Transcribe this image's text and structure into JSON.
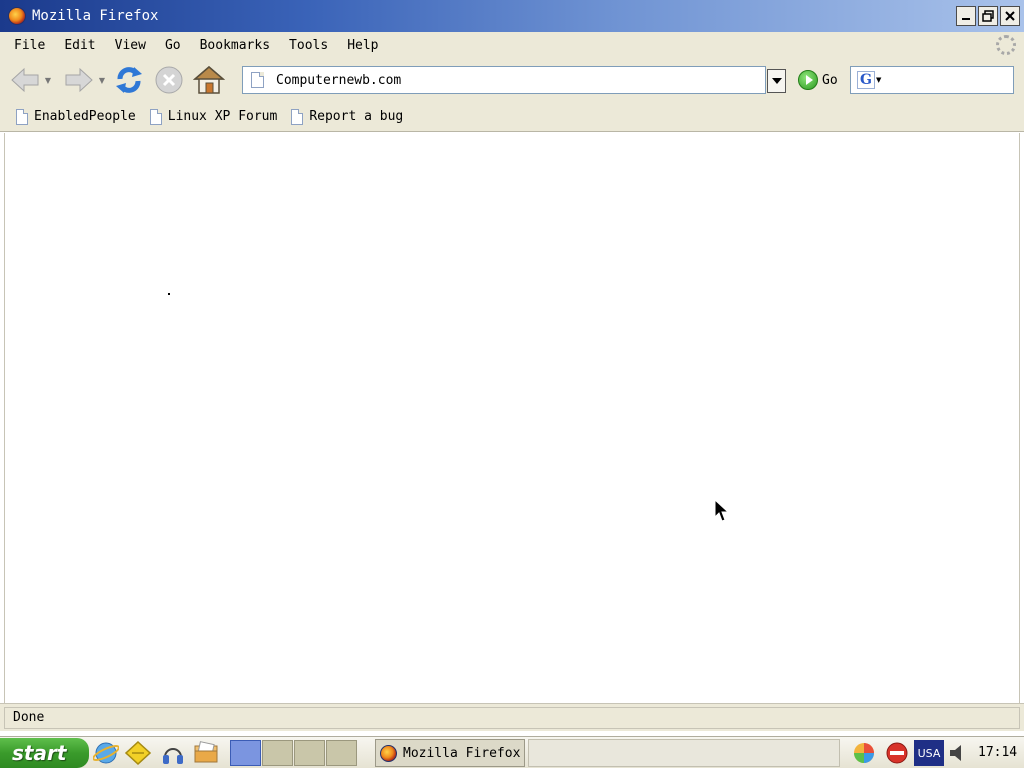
{
  "window": {
    "title": "Mozilla Firefox",
    "buttons": {
      "minimize": "minimize-icon",
      "restore": "restore-icon",
      "close": "close-icon"
    }
  },
  "menubar": {
    "items": [
      {
        "label": "File"
      },
      {
        "label": "Edit"
      },
      {
        "label": "View"
      },
      {
        "label": "Go"
      },
      {
        "label": "Bookmarks"
      },
      {
        "label": "Tools"
      },
      {
        "label": "Help"
      }
    ]
  },
  "navbar": {
    "icons": [
      "back-icon",
      "forward-icon",
      "reload-icon",
      "stop-icon",
      "home-icon"
    ],
    "url": "Computernewb.com",
    "go_label": "Go",
    "search_value": ""
  },
  "bookmarks": {
    "items": [
      {
        "label": "EnabledPeople"
      },
      {
        "label": "Linux XP Forum"
      },
      {
        "label": "Report a bug"
      }
    ]
  },
  "status": {
    "text": "Done"
  },
  "taskbar": {
    "start_label": "start",
    "task_label": "Mozilla Firefox",
    "keyboard_layout": "USA",
    "clock": "17:14"
  },
  "colors": {
    "titlebar_start": "#1b3a8c",
    "titlebar_end": "#a9c2ea",
    "chrome_bg": "#ece9d8",
    "start_green": "#3a9b2b",
    "usa_bg": "#1f2f86"
  }
}
